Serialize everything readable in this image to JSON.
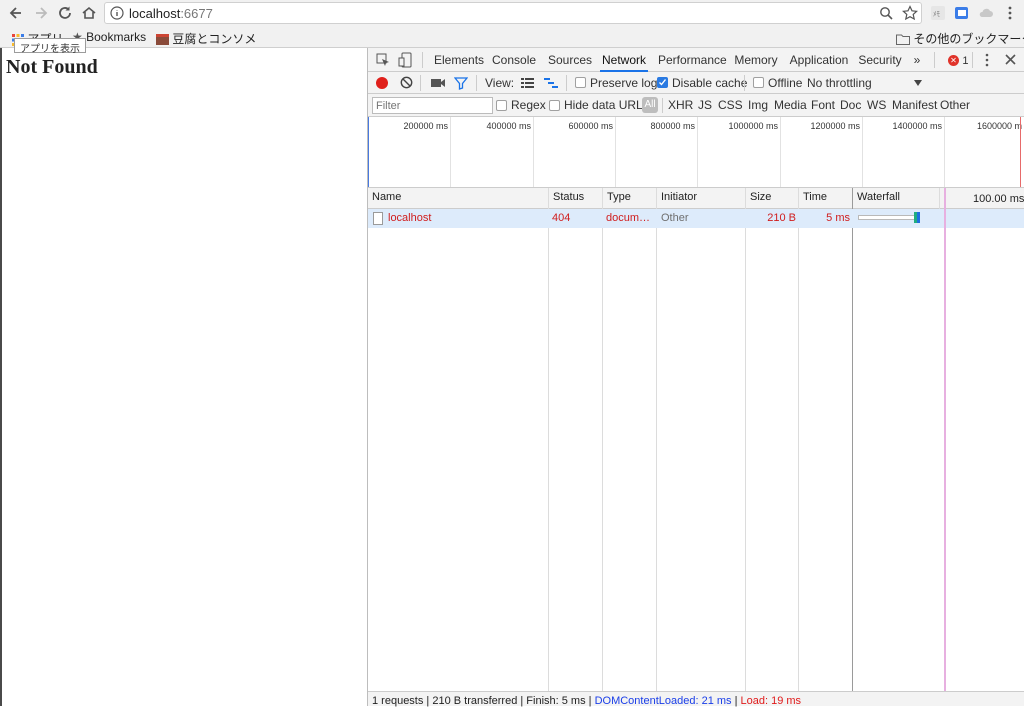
{
  "browser": {
    "url_host": "localhost",
    "url_port": ":6677",
    "bookmarks": {
      "apps_label": "アプリ",
      "bookmarks_label": "Bookmarks",
      "item_label": "豆腐とコンソメ",
      "other_label": "その他のブックマーク"
    },
    "tooltip": "アプリを表示"
  },
  "page": {
    "heading": "Not Found"
  },
  "devtools": {
    "tabs": [
      "Elements",
      "Console",
      "Sources",
      "Network",
      "Performance",
      "Memory",
      "Application",
      "Security"
    ],
    "active_tab": "Network",
    "more_tabs": "»",
    "error_count": "1",
    "toolbar": {
      "view_label": "View:",
      "preserve_log": "Preserve log",
      "disable_cache": "Disable cache",
      "offline": "Offline",
      "throttling": "No throttling"
    },
    "filter": {
      "placeholder": "Filter",
      "regex": "Regex",
      "hide_data_urls": "Hide data URLs",
      "all": "All",
      "types": [
        "XHR",
        "JS",
        "CSS",
        "Img",
        "Media",
        "Font",
        "Doc",
        "WS",
        "Manifest",
        "Other"
      ]
    },
    "overview_ticks": [
      "200000 ms",
      "400000 ms",
      "600000 ms",
      "800000 ms",
      "1000000 ms",
      "1200000 ms",
      "1400000 ms",
      "1600000 m"
    ],
    "columns": {
      "name": "Name",
      "status": "Status",
      "type": "Type",
      "initiator": "Initiator",
      "size": "Size",
      "time": "Time",
      "waterfall": "Waterfall",
      "waterfall_scale": "100.00 ms"
    },
    "requests": [
      {
        "name": "localhost",
        "status": "404",
        "type": "docum…",
        "initiator": "Other",
        "size": "210 B",
        "time": "5 ms"
      }
    ],
    "status_bar": {
      "summary": "1 requests | 210 B transferred | Finish: 5 ms | ",
      "dom_content_loaded": "DOMContentLoaded: 21 ms",
      "separator": " | ",
      "load": "Load: 19 ms"
    },
    "colors": {
      "accent": "#1a73e8",
      "error": "#d01d1d",
      "row_selected": "#ddebfb"
    }
  }
}
